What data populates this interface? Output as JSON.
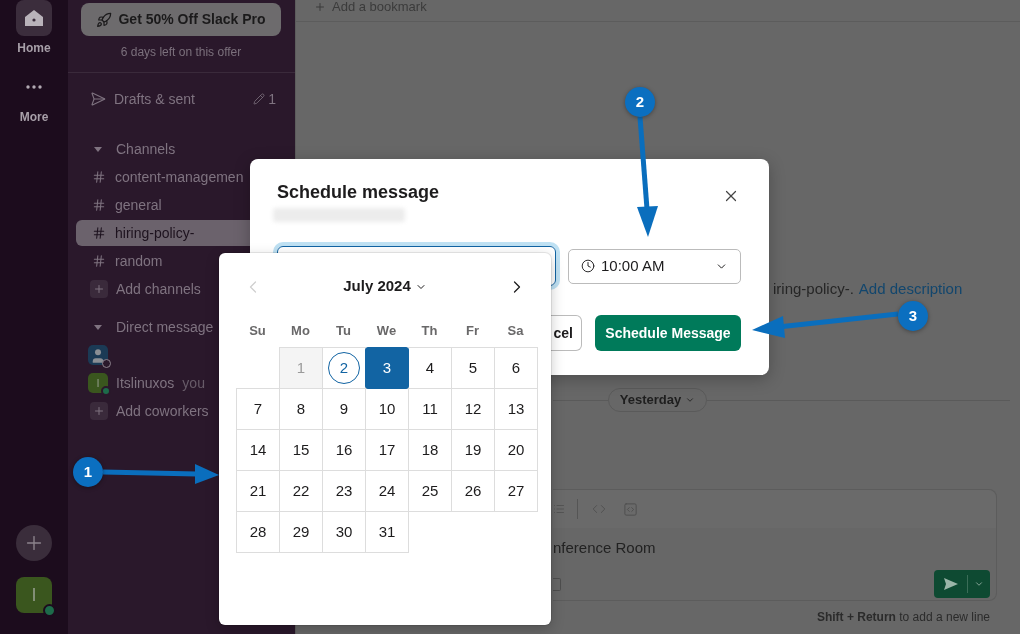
{
  "rail": {
    "items": [
      {
        "kind": "home",
        "label": "Home",
        "selected": true
      },
      {
        "kind": "more",
        "label": "More",
        "selected": false
      }
    ],
    "user": {
      "initial": "I",
      "active": true
    }
  },
  "sidebar": {
    "promo": {
      "button": "Get 50% Off Slack Pro",
      "note": "6 days left on this offer"
    },
    "drafts": {
      "label": "Drafts & sent",
      "count": "1"
    },
    "channels": {
      "title": "Channels",
      "expanded": true,
      "items": [
        {
          "name": "content-managemen",
          "selected": false
        },
        {
          "name": "general",
          "selected": false
        },
        {
          "name": "hiring-policy-",
          "selected": true
        },
        {
          "name": "random",
          "selected": false
        }
      ],
      "add_label": "Add channels"
    },
    "direct_messages": {
      "title": "Direct message",
      "expanded": true,
      "items": [
        {
          "kind": "silhouette",
          "active": false
        },
        {
          "kind": "initial",
          "initial": "I",
          "name": "Itslinuxos",
          "suffix": "you",
          "active": true
        }
      ],
      "add_label": "Add coworkers"
    }
  },
  "main": {
    "bookmark": "Add a bookmark",
    "intro": "iring-policy-.",
    "intro_link": "Add description",
    "divider_label": "Yesterday",
    "composer": {
      "text": "nference Room"
    },
    "hint": "**Shift + Return** to add a new line"
  },
  "modal": {
    "title": "Schedule message",
    "time": "10:00 AM",
    "buttons": [
      {
        "kind": "secondary",
        "label": "cel"
      },
      {
        "kind": "primary",
        "label": "Schedule Message"
      }
    ]
  },
  "calendar": {
    "month": "July 2024",
    "prev_disabled": true,
    "weekdays": [
      "Su",
      "Mo",
      "Tu",
      "We",
      "Th",
      "Fr",
      "Sa"
    ],
    "weeks": [
      {
        "days": [
          {
            "label": "1",
            "selected": false,
            "today": false,
            "disabled": true
          },
          {
            "label": "2",
            "selected": false,
            "today": true,
            "disabled": false
          },
          {
            "label": "3",
            "selected": true,
            "today": false,
            "disabled": false
          },
          {
            "label": "4",
            "selected": false,
            "today": false,
            "disabled": false
          },
          {
            "label": "5",
            "selected": false,
            "today": false,
            "disabled": false
          },
          {
            "label": "6",
            "selected": false,
            "today": false,
            "disabled": false
          }
        ]
      },
      {
        "days": [
          {
            "label": "7",
            "selected": false,
            "today": false,
            "disabled": false
          },
          {
            "label": "8",
            "selected": false,
            "today": false,
            "disabled": false
          },
          {
            "label": "9",
            "selected": false,
            "today": false,
            "disabled": false
          },
          {
            "label": "10",
            "selected": false,
            "today": false,
            "disabled": false
          },
          {
            "label": "11",
            "selected": false,
            "today": false,
            "disabled": false
          },
          {
            "label": "12",
            "selected": false,
            "today": false,
            "disabled": false
          },
          {
            "label": "13",
            "selected": false,
            "today": false,
            "disabled": false
          }
        ]
      },
      {
        "days": [
          {
            "label": "14",
            "selected": false,
            "today": false,
            "disabled": false
          },
          {
            "label": "15",
            "selected": false,
            "today": false,
            "disabled": false
          },
          {
            "label": "16",
            "selected": false,
            "today": false,
            "disabled": false
          },
          {
            "label": "17",
            "selected": false,
            "today": false,
            "disabled": false
          },
          {
            "label": "18",
            "selected": false,
            "today": false,
            "disabled": false
          },
          {
            "label": "19",
            "selected": false,
            "today": false,
            "disabled": false
          },
          {
            "label": "20",
            "selected": false,
            "today": false,
            "disabled": false
          }
        ]
      },
      {
        "days": [
          {
            "label": "21",
            "selected": false,
            "today": false,
            "disabled": false
          },
          {
            "label": "22",
            "selected": false,
            "today": false,
            "disabled": false
          },
          {
            "label": "23",
            "selected": false,
            "today": false,
            "disabled": false
          },
          {
            "label": "24",
            "selected": false,
            "today": false,
            "disabled": false
          },
          {
            "label": "25",
            "selected": false,
            "today": false,
            "disabled": false
          },
          {
            "label": "26",
            "selected": false,
            "today": false,
            "disabled": false
          },
          {
            "label": "27",
            "selected": false,
            "today": false,
            "disabled": false
          }
        ]
      },
      {
        "days": [
          {
            "label": "28",
            "selected": false,
            "today": false,
            "disabled": false
          },
          {
            "label": "29",
            "selected": false,
            "today": false,
            "disabled": false
          },
          {
            "label": "30",
            "selected": false,
            "today": false,
            "disabled": false
          },
          {
            "label": "31",
            "selected": false,
            "today": false,
            "disabled": false
          }
        ]
      }
    ]
  },
  "annotations": [
    {
      "label": "1"
    },
    {
      "label": "2"
    },
    {
      "label": "3"
    }
  ]
}
